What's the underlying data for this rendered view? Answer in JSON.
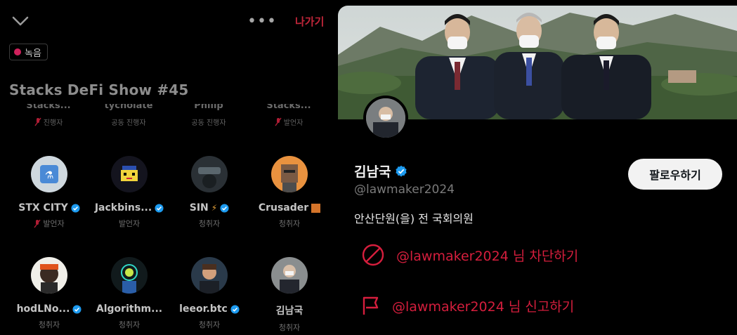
{
  "space": {
    "leave_label": "나가기",
    "more_label": "•••",
    "recording_label": "녹음",
    "title": "Stacks DeFi Show #45",
    "cut_row": [
      {
        "name": "Stacks...",
        "role": "진행자",
        "mic_off": true
      },
      {
        "name": "tycholate",
        "role": "공동 진행자",
        "mic_off": false
      },
      {
        "name": "Philip",
        "role": "공동 진행자",
        "mic_off": false
      },
      {
        "name": "Stacks...",
        "role": "발언자",
        "mic_off": true
      }
    ],
    "participants": [
      {
        "name": "STX CITY",
        "role": "발언자",
        "verified": true,
        "mic_off": true
      },
      {
        "name": "Jackbins...",
        "role": "발언자",
        "verified": true,
        "mic_off": false
      },
      {
        "name": "SIN",
        "role": "청취자",
        "verified": true,
        "mic_off": false
      },
      {
        "name": "Crusader",
        "role": "청취자",
        "verified": false,
        "mic_off": false
      },
      {
        "name": "hodLNo...",
        "role": "청취자",
        "verified": true,
        "mic_off": false
      },
      {
        "name": "Algorithm...",
        "role": "청취자",
        "verified": false,
        "mic_off": false
      },
      {
        "name": "leeor.btc",
        "role": "청취자",
        "verified": true,
        "mic_off": false
      },
      {
        "name": "김남국",
        "role": "청취자",
        "verified": false,
        "mic_off": false
      }
    ]
  },
  "profile": {
    "display_name": "김남국",
    "handle": "@lawmaker2024",
    "bio": "안산단원(을) 전 국회의원",
    "follow_label": "팔로우하기",
    "block_label": "@lawmaker2024 님 차단하기",
    "report_label": "@lawmaker2024 님 신고하기"
  },
  "colors": {
    "accent_red": "#d51e3d",
    "verified_blue": "#1d9bf0",
    "background": "#000000",
    "follow_button_bg": "#f2f2f2"
  },
  "icons": {
    "collapse": "chevron-down-icon",
    "block": "block-icon",
    "report": "flag-icon",
    "verified": "verified-badge-icon",
    "mic_off": "mic-off-icon"
  }
}
